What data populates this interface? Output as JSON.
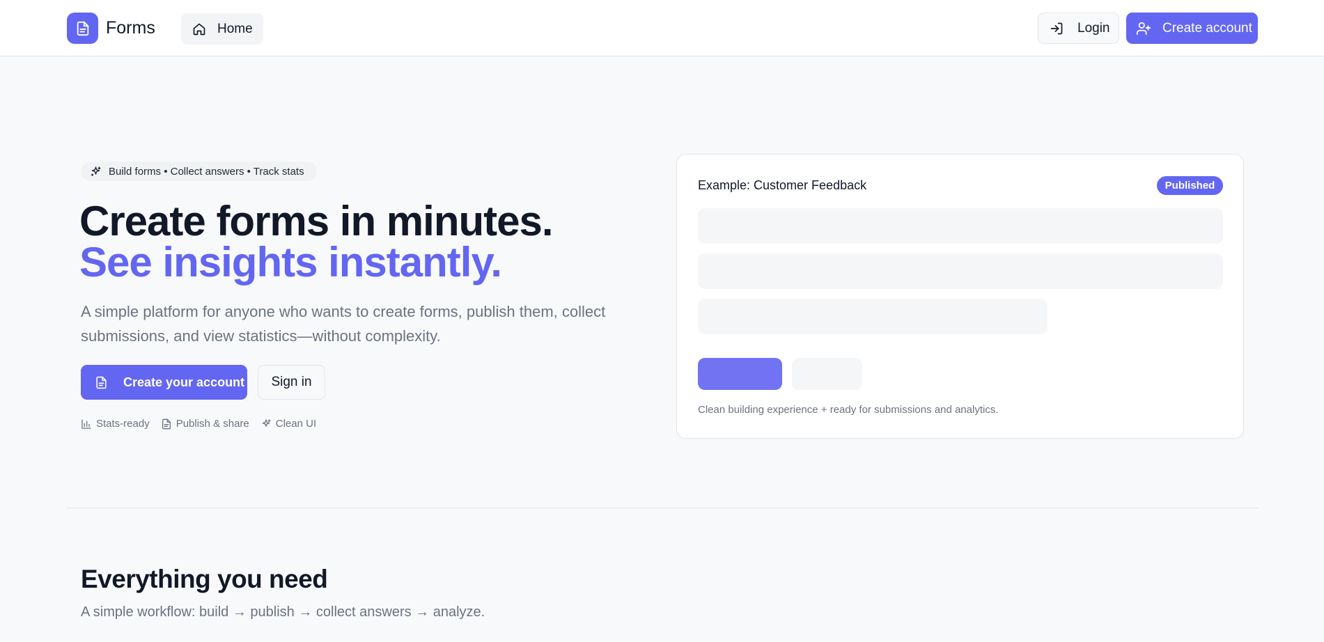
{
  "nav": {
    "brand": "Forms",
    "home_label": "Home",
    "login_label": "Login",
    "create_account_label": "Create account"
  },
  "hero": {
    "pill": "Build forms • Collect answers • Track stats",
    "headline_line1": "Create forms in minutes.",
    "headline_line2": "See insights instantly.",
    "subtext": "A simple platform for anyone who wants to create forms, publish them, collect submissions, and view statistics—without complexity.",
    "cta_primary": "Create your account",
    "cta_secondary": "Sign in",
    "features": [
      "Stats-ready",
      "Publish & share",
      "Clean UI"
    ]
  },
  "preview_card": {
    "title": "Example: Customer Feedback",
    "status_badge": "Published",
    "caption": "Clean building experience + ready for submissions and analytics."
  },
  "section": {
    "title": "Everything you need",
    "subtitle": "A simple workflow: build → publish → collect answers → analyze."
  },
  "colors": {
    "accent": "#6366f1",
    "text": "#111827",
    "muted": "#6b7280",
    "background": "#f8f9fb"
  },
  "icons": {
    "brand": "document-icon",
    "home": "home-icon",
    "login": "login-icon",
    "create_account": "user-plus-icon",
    "pill": "sparkles-icon",
    "cta_primary": "document-icon",
    "features": [
      "bar-chart-icon",
      "document-icon",
      "sparkles-icon"
    ]
  }
}
